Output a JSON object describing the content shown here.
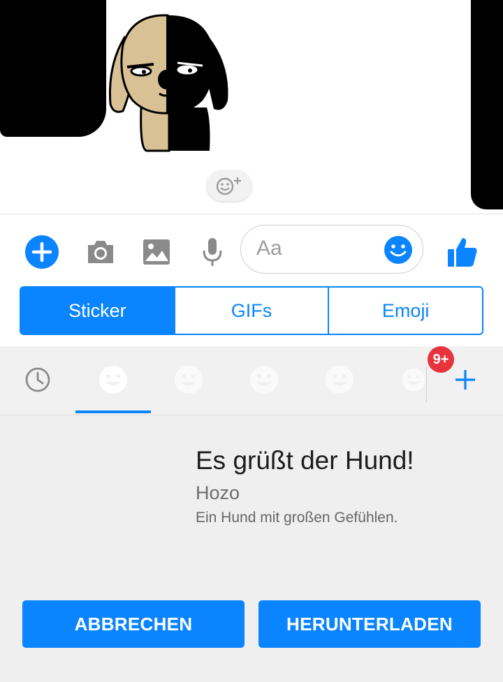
{
  "composer": {
    "placeholder": "Aa"
  },
  "tabs": [
    {
      "label": "Sticker",
      "active": true
    },
    {
      "label": "GIFs",
      "active": false
    },
    {
      "label": "Emoji",
      "active": false
    }
  ],
  "packs": {
    "badge": "9+",
    "items": [
      "recent-icon",
      "smiley-icon",
      "smiley-icon",
      "smiley-icon",
      "smiley-icon",
      "smiley-icon"
    ],
    "selected_index": 1
  },
  "pack_detail": {
    "title": "Es grüßt der Hund!",
    "author": "Hozo",
    "description": "Ein Hund mit großen Gefühlen."
  },
  "actions": {
    "cancel_label": "ABBRECHEN",
    "download_label": "HERUNTERLADEN"
  },
  "colors": {
    "accent": "#0a84ff",
    "badge": "#e8323c",
    "panel_bg": "#efefef"
  }
}
